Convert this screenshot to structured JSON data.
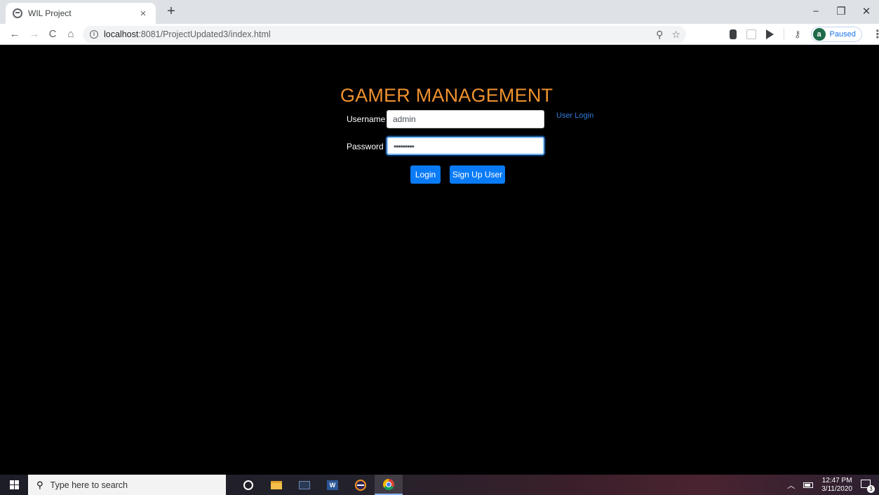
{
  "browser": {
    "tab_title": "WIL Project",
    "tab_close": "×",
    "new_tab": "+",
    "window_controls": {
      "minimize": "−",
      "maximize": "❐",
      "close": "✕"
    },
    "nav": {
      "back": "←",
      "forward": "→",
      "reload": "C",
      "home": "⌂"
    },
    "url_host": "localhost",
    "url_rest": ":8081/ProjectUpdated3/index.html",
    "profile_initial": "a",
    "profile_status": "Paused"
  },
  "page": {
    "title": "GAMER MANAGEMENT",
    "username_label": "Username",
    "username_value": "admin",
    "password_label": "Password",
    "password_value": "•••••••••",
    "user_login_link": "User Login",
    "login_button": "Login",
    "signup_button": "Sign Up User",
    "title_color": "#f0922e",
    "button_color": "#0a7bf6"
  },
  "taskbar": {
    "search_placeholder": "Type here to search",
    "word_icon_letter": "W",
    "time": "12:47 PM",
    "date": "3/11/2020",
    "notification_count": "3"
  }
}
